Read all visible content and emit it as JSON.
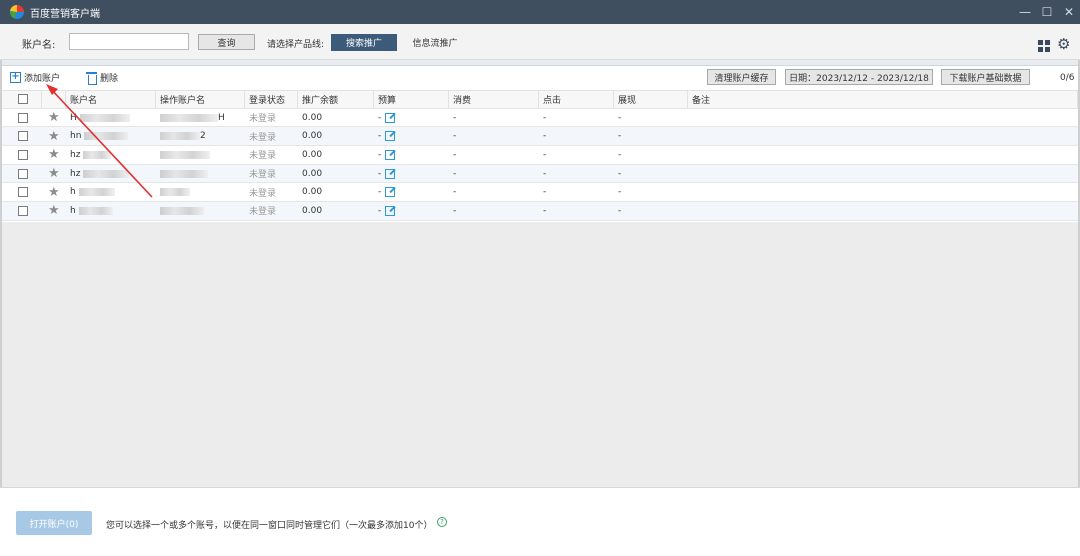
{
  "window": {
    "title": "百度营销客户端",
    "controls": [
      "—",
      "☐",
      "✕"
    ]
  },
  "toolbar": {
    "account_label": "账户名:",
    "account_value": "",
    "query_button": "查询",
    "product_label": "请选择产品线:",
    "tab_search": "搜索推广",
    "tab_feed": "信息流推广"
  },
  "actions": {
    "add_account": "添加账户",
    "delete": "删除",
    "clear_cache": "清理账户缓存",
    "date_range": "日期：2023/12/12 - 2023/12/18",
    "download": "下载账户基础数据",
    "count": "0/6"
  },
  "table": {
    "headers": [
      "账户名",
      "操作账户名",
      "登录状态",
      "推广余额",
      "预算",
      "消费",
      "点击",
      "展现",
      "备注"
    ],
    "rows": [
      {
        "name": "H",
        "op": "H",
        "status": "未登录",
        "balance": "0.00",
        "budget": "-",
        "cost": "-",
        "click": "-",
        "show": "-",
        "note": ""
      },
      {
        "name": "hn",
        "op": "2",
        "status": "未登录",
        "balance": "0.00",
        "budget": "-",
        "cost": "-",
        "click": "-",
        "show": "-",
        "note": ""
      },
      {
        "name": "hz",
        "op": "",
        "status": "未登录",
        "balance": "0.00",
        "budget": "-",
        "cost": "-",
        "click": "-",
        "show": "-",
        "note": ""
      },
      {
        "name": "hz",
        "op": "",
        "status": "未登录",
        "balance": "0.00",
        "budget": "-",
        "cost": "-",
        "click": "-",
        "show": "-",
        "note": ""
      },
      {
        "name": "h",
        "op": "",
        "status": "未登录",
        "balance": "0.00",
        "budget": "-",
        "cost": "-",
        "click": "-",
        "show": "-",
        "note": ""
      },
      {
        "name": "h",
        "op": "",
        "status": "未登录",
        "balance": "0.00",
        "budget": "-",
        "cost": "-",
        "click": "-",
        "show": "-",
        "note": ""
      }
    ]
  },
  "footer": {
    "open_button": "打开账户(0)",
    "hint": "您可以选择一个或多个账号，以便在同一窗口同时管理它们（一次最多添加10个）",
    "help": "?"
  },
  "colors": {
    "titlebar": "#3f4f60",
    "accent_tab": "#3c5a7a",
    "annotation_arrow": "#e03030"
  }
}
